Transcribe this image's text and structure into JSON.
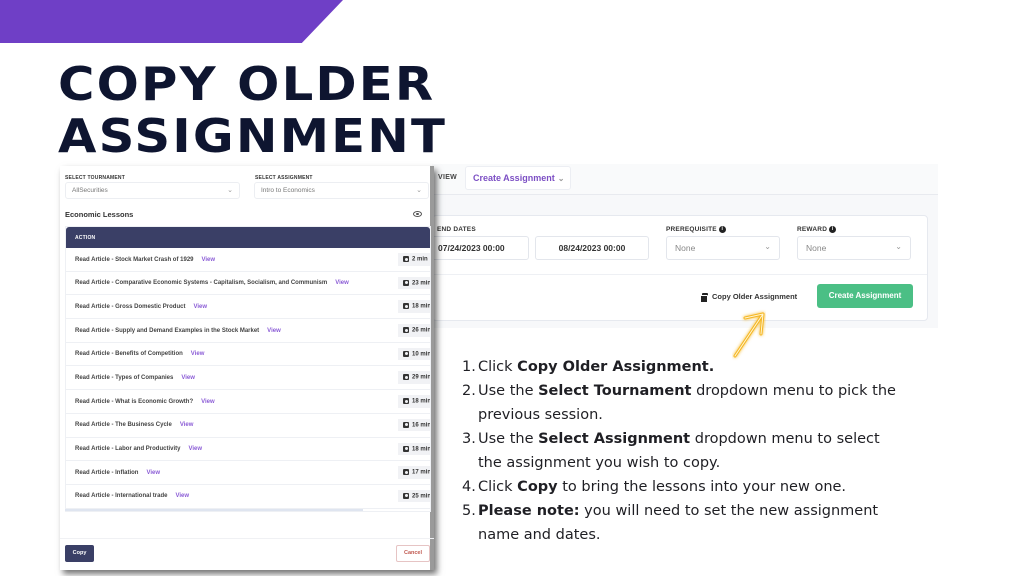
{
  "slide": {
    "title_line1": "COPY OLDER",
    "title_line2": "ASSIGNMENT",
    "accent_color": "#6f3fc6"
  },
  "app": {
    "tab_view_label": "VIEW",
    "tab_create_label": "Create Assignment",
    "end_dates_label": "END DATES",
    "start_date_value": "07/24/2023 00:00",
    "end_date_value": "08/24/2023 00:00",
    "prerequisite_label": "PREREQUISITE",
    "prerequisite_value": "None",
    "reward_label": "REWARD",
    "reward_value": "None",
    "copy_older_label": "Copy Older Assignment",
    "create_button_label": "Create Assignment"
  },
  "modal": {
    "select_tournament_label": "SELECT TOURNAMENT",
    "select_tournament_value": "AllSecurities",
    "select_assignment_label": "SELECT ASSIGNMENT",
    "select_assignment_value": "Intro to Economics",
    "section_title": "Economic Lessons",
    "table_header": "ACTION",
    "view_label": "View",
    "rows": [
      {
        "title": "Read Article - Stock Market Crash of 1929",
        "duration": "2 min"
      },
      {
        "title": "Read Article - Comparative Economic Systems - Capitalism, Socialism, and Communism",
        "duration": "23 min"
      },
      {
        "title": "Read Article - Gross Domestic Product",
        "duration": "18 min"
      },
      {
        "title": "Read Article - Supply and Demand Examples in the Stock Market",
        "duration": "26 min"
      },
      {
        "title": "Read Article - Benefits of Competition",
        "duration": "10 min"
      },
      {
        "title": "Read Article - Types of Companies",
        "duration": "29 min"
      },
      {
        "title": "Read Article - What is Economic Growth?",
        "duration": "18 min"
      },
      {
        "title": "Read Article - The Business Cycle",
        "duration": "16 min"
      },
      {
        "title": "Read Article - Labor and Productivity",
        "duration": "18 min"
      },
      {
        "title": "Read Article - Inflation",
        "duration": "17 min"
      },
      {
        "title": "Read Article - International trade",
        "duration": "25 min"
      }
    ],
    "copy_button": "Copy",
    "cancel_button": "Cancel"
  },
  "instructions": [
    {
      "num": "1.",
      "pre": "Click ",
      "bold": "Copy Older Assignment.",
      "post": ""
    },
    {
      "num": "2.",
      "pre": "Use the ",
      "bold": "Select Tournament",
      "post": " dropdown menu to pick the previous session."
    },
    {
      "num": "3.",
      "pre": "Use the ",
      "bold": "Select Assignment",
      "post": " dropdown menu to select the assignment you wish to copy."
    },
    {
      "num": "4.",
      "pre": "Click ",
      "bold": "Copy",
      "post": " to bring the lessons into your new one."
    },
    {
      "num": "5.",
      "pre": "",
      "bold": "Please note:",
      "post": " you will need to set the new assignment name and dates."
    }
  ]
}
